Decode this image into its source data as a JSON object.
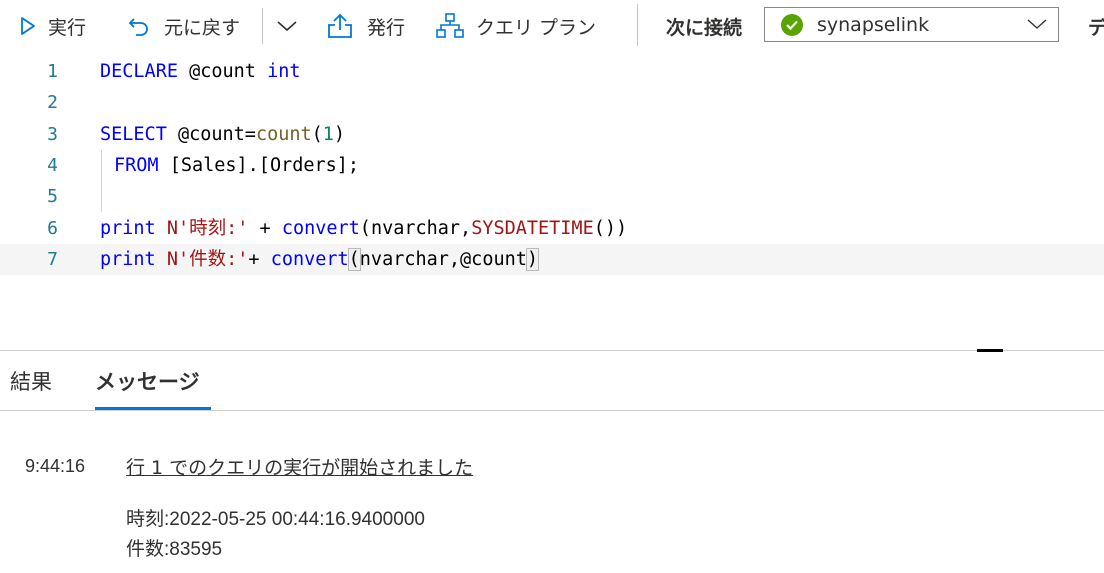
{
  "toolbar": {
    "run_label": "実行",
    "undo_label": "元に戻す",
    "publish_label": "発行",
    "query_plan_label": "クエリ プラン",
    "connect_label": "次に接続",
    "connection_value": "synapselink",
    "truncated_label": "デ"
  },
  "editor": {
    "line_numbers": [
      "1",
      "2",
      "3",
      "4",
      "5",
      "6",
      "7"
    ],
    "lines": {
      "l1": {
        "kw1": "DECLARE",
        "t1": " @count ",
        "kw2": "int"
      },
      "l3": {
        "kw1": "SELECT",
        "t1": " @count=",
        "fn": "count",
        "p1": "(",
        "num": "1",
        "p2": ")"
      },
      "l4": {
        "kw1": "FROM",
        "t1": " [Sales].[Orders];"
      },
      "l6": {
        "kw1": "print",
        "sp1": " ",
        "str": "N'時刻:'",
        "t1": " + ",
        "kw2": "convert",
        "p1": "(",
        "t2": "nvarchar,",
        "fn": "SYSDATETIME",
        "t3": "())"
      },
      "l7": {
        "kw1": "print",
        "sp1": " ",
        "str": "N'件数:'",
        "t1": "+ ",
        "kw2": "convert",
        "p1": "(",
        "t2": "nvarchar,@count",
        "p2": ")"
      }
    }
  },
  "results": {
    "tabs": [
      "結果",
      "メッセージ"
    ],
    "active_tab": "メッセージ",
    "timestamp": "9:44:16",
    "start_message": "行 1 でのクエリの実行が開始されました",
    "output_lines": [
      "時刻:2022-05-25 00:44:16.9400000",
      "件数:83595"
    ]
  },
  "colors": {
    "accent": "#0078d4",
    "status_ok": "#57a300",
    "keyword": "#0000ff",
    "string": "#a31515"
  }
}
